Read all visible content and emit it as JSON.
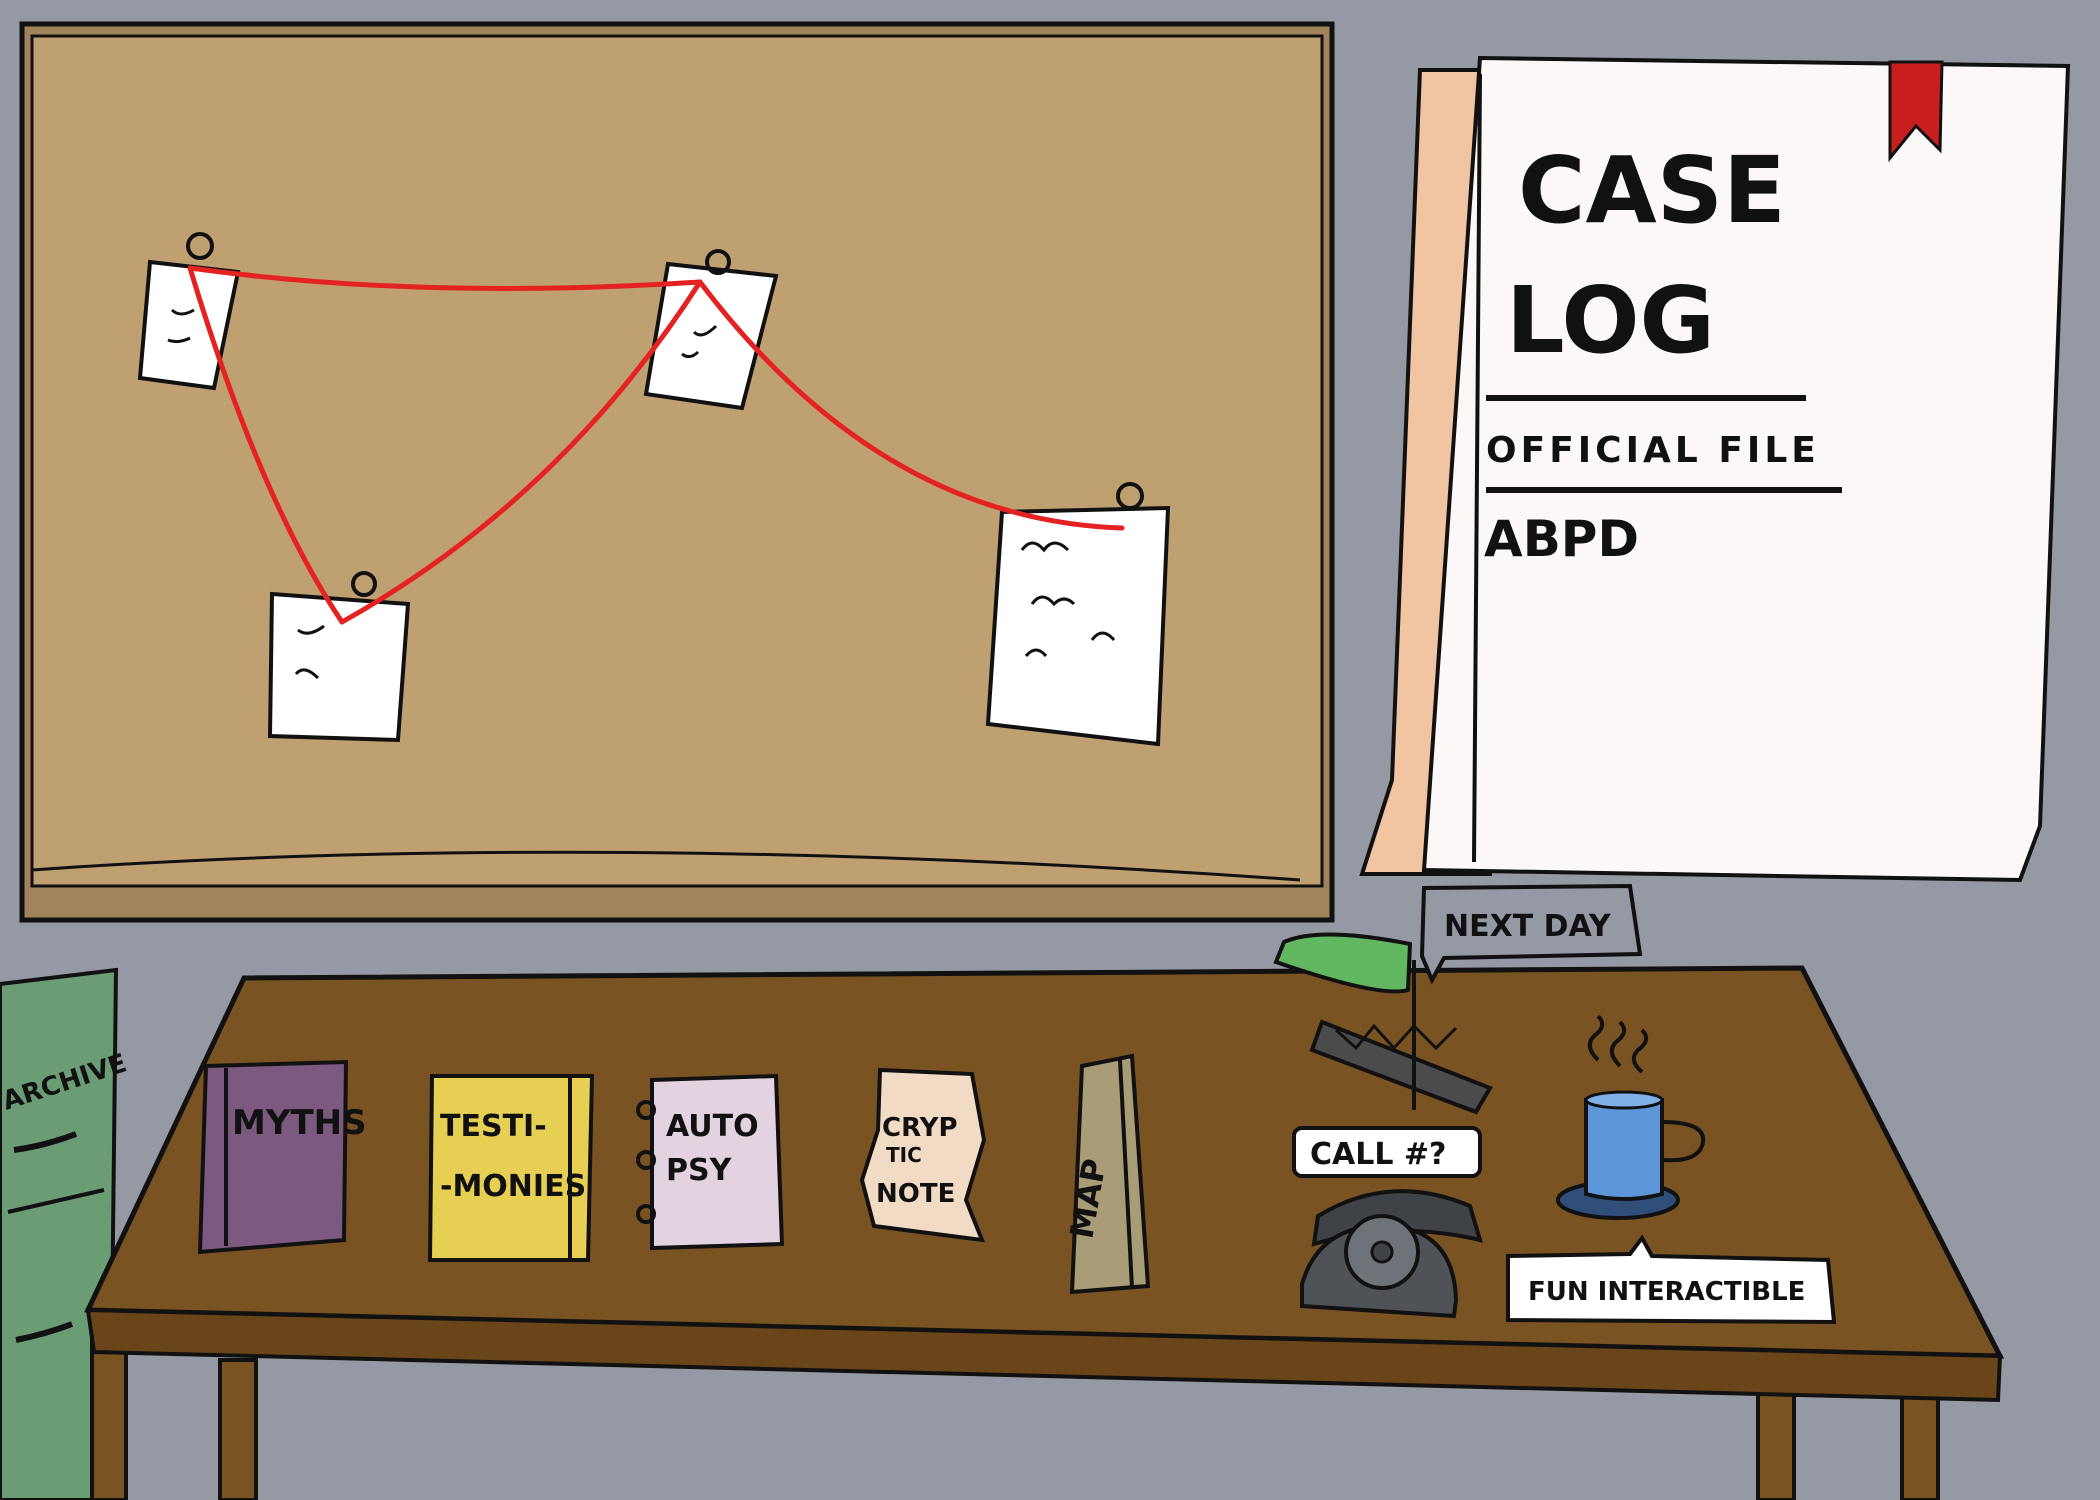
{
  "scene": {
    "background": "#9599a4",
    "corkboard": {
      "color": "#bfa071",
      "frame": "#a0845d"
    },
    "string_color": "#e52222"
  },
  "case_log": {
    "title_line1": "CASE",
    "title_line2": "LOG",
    "subtitle": "OFFICIAL FILE",
    "department": "ABPD",
    "paper_color": "#fdf8f8",
    "spine_color": "#f1c5a1",
    "bookmark_color": "#c81e1e"
  },
  "archive": {
    "label": "ARCHIVE",
    "color": "#6b9d74"
  },
  "desk_items": {
    "myths": {
      "label": "MYTHS",
      "color": "#7c5a80"
    },
    "testimonies": {
      "line1": "TESTI-",
      "line2": "-MONIES",
      "color": "#e7cf54"
    },
    "autopsy": {
      "line1": "AUTO",
      "line2": "PSY",
      "color": "#e3d2df"
    },
    "cryptic_note": {
      "line1": "CRYP",
      "line2": "TIC",
      "line3": "NOTE",
      "color": "#f1dbc5"
    },
    "map": {
      "label": "MAP",
      "color": "#a89d76"
    }
  },
  "lamp": {
    "tooltip": "NEXT DAY",
    "shade_color": "#62b860"
  },
  "phone": {
    "tooltip": "CALL #?",
    "color": "#4f5358"
  },
  "mug": {
    "tooltip": "FUN INTERACTIBLE",
    "color": "#5d96d8"
  },
  "desk": {
    "color": "#7a5322"
  }
}
